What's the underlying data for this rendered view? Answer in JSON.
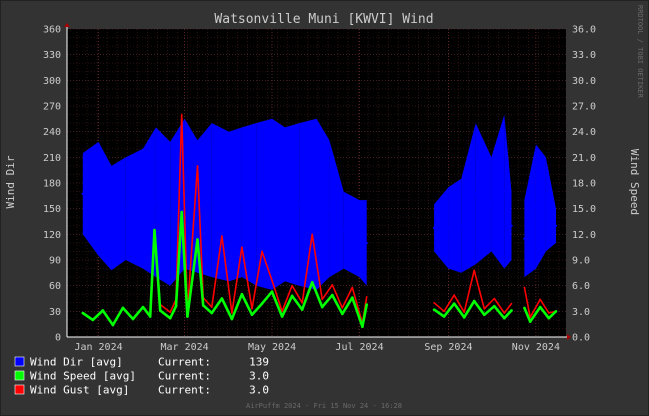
{
  "chart_data": {
    "type": "area",
    "title": "Watsonville Muni [KWVI] Wind",
    "ylabel": "Wind Dir",
    "y2label": "Wind Speed",
    "ylim": [
      0,
      360
    ],
    "y2lim": [
      0,
      36
    ],
    "yticks": [
      "0",
      "30",
      "60",
      "90",
      "120",
      "150",
      "180",
      "210",
      "240",
      "270",
      "300",
      "330",
      "360"
    ],
    "y2ticks": [
      "0.0",
      "3.0",
      "6.0",
      "9.0",
      "12.0",
      "15.0",
      "18.0",
      "21.0",
      "24.0",
      "27.0",
      "30.0",
      "33.0",
      "36.0"
    ],
    "xlim": [
      "2023-12-10",
      "2024-11-22"
    ],
    "xticks": [
      {
        "date": "2024-01-01",
        "label": "Jan 2024"
      },
      {
        "date": "2024-03-01",
        "label": "Mar 2024"
      },
      {
        "date": "2024-05-01",
        "label": "May 2024"
      },
      {
        "date": "2024-07-01",
        "label": "Jul 2024"
      },
      {
        "date": "2024-09-01",
        "label": "Sep 2024"
      },
      {
        "date": "2024-11-01",
        "label": "Nov 2024"
      }
    ],
    "grid": true,
    "legend_position": "bottom-left",
    "watermark": "RRDTOOL / TOBI OETIKER",
    "footer": "AirPuffm 2024 - Fri 15 Nov 24 - 16:28",
    "gaps": [
      [
        "2024-07-07",
        "2024-08-21"
      ],
      [
        "2024-10-16",
        "2024-10-23"
      ]
    ],
    "series": [
      {
        "name": "Wind Dir",
        "axis": "left",
        "style": "band",
        "color": "#0000ff",
        "legend_label": "Wind Dir   [avg]",
        "current_label": "Current:",
        "current": "139",
        "points": [
          {
            "x": "2023-12-21",
            "low": 120,
            "high": 215
          },
          {
            "x": "2024-01-01",
            "low": 95,
            "high": 228
          },
          {
            "x": "2024-01-10",
            "low": 78,
            "high": 200
          },
          {
            "x": "2024-01-20",
            "low": 90,
            "high": 210
          },
          {
            "x": "2024-02-01",
            "low": 80,
            "high": 220
          },
          {
            "x": "2024-02-10",
            "low": 70,
            "high": 245
          },
          {
            "x": "2024-02-20",
            "low": 60,
            "high": 228
          },
          {
            "x": "2024-03-01",
            "low": 80,
            "high": 255
          },
          {
            "x": "2024-03-10",
            "low": 75,
            "high": 230
          },
          {
            "x": "2024-03-20",
            "low": 70,
            "high": 250
          },
          {
            "x": "2024-04-01",
            "low": 65,
            "high": 240
          },
          {
            "x": "2024-04-10",
            "low": 70,
            "high": 245
          },
          {
            "x": "2024-04-20",
            "low": 60,
            "high": 250
          },
          {
            "x": "2024-05-01",
            "low": 55,
            "high": 255
          },
          {
            "x": "2024-05-10",
            "low": 65,
            "high": 245
          },
          {
            "x": "2024-05-20",
            "low": 60,
            "high": 250
          },
          {
            "x": "2024-06-01",
            "low": 55,
            "high": 255
          },
          {
            "x": "2024-06-10",
            "low": 70,
            "high": 230
          },
          {
            "x": "2024-06-20",
            "low": 80,
            "high": 170
          },
          {
            "x": "2024-07-01",
            "low": 70,
            "high": 160
          },
          {
            "x": "2024-07-06",
            "low": 60,
            "high": 160
          },
          {
            "x": "2024-08-22",
            "low": 100,
            "high": 155
          },
          {
            "x": "2024-09-01",
            "low": 80,
            "high": 175
          },
          {
            "x": "2024-09-10",
            "low": 75,
            "high": 185
          },
          {
            "x": "2024-09-20",
            "low": 85,
            "high": 250
          },
          {
            "x": "2024-10-01",
            "low": 100,
            "high": 210
          },
          {
            "x": "2024-10-10",
            "low": 80,
            "high": 260
          },
          {
            "x": "2024-10-15",
            "low": 90,
            "high": 170
          },
          {
            "x": "2024-10-24",
            "low": 70,
            "high": 160
          },
          {
            "x": "2024-11-01",
            "low": 80,
            "high": 225
          },
          {
            "x": "2024-11-08",
            "low": 100,
            "high": 210
          },
          {
            "x": "2024-11-15",
            "low": 110,
            "high": 150
          }
        ]
      },
      {
        "name": "Wind Speed",
        "axis": "right",
        "style": "line",
        "color": "#00ff00",
        "legend_label": "Wind Speed [avg]",
        "current_label": "Current:",
        "current": "3.0",
        "points": [
          {
            "x": "2023-12-21",
            "y": 2.8
          },
          {
            "x": "2023-12-28",
            "y": 2.0
          },
          {
            "x": "2024-01-04",
            "y": 3.1
          },
          {
            "x": "2024-01-11",
            "y": 1.4
          },
          {
            "x": "2024-01-18",
            "y": 3.4
          },
          {
            "x": "2024-01-25",
            "y": 2.1
          },
          {
            "x": "2024-02-01",
            "y": 3.5
          },
          {
            "x": "2024-02-06",
            "y": 2.4
          },
          {
            "x": "2024-02-09",
            "y": 12.5
          },
          {
            "x": "2024-02-13",
            "y": 3.1
          },
          {
            "x": "2024-02-20",
            "y": 2.2
          },
          {
            "x": "2024-02-24",
            "y": 3.6
          },
          {
            "x": "2024-02-28",
            "y": 14.6
          },
          {
            "x": "2024-03-03",
            "y": 2.4
          },
          {
            "x": "2024-03-10",
            "y": 11.4
          },
          {
            "x": "2024-03-14",
            "y": 3.7
          },
          {
            "x": "2024-03-20",
            "y": 2.8
          },
          {
            "x": "2024-03-27",
            "y": 4.5
          },
          {
            "x": "2024-04-03",
            "y": 2.1
          },
          {
            "x": "2024-04-10",
            "y": 5.0
          },
          {
            "x": "2024-04-17",
            "y": 2.6
          },
          {
            "x": "2024-04-24",
            "y": 3.9
          },
          {
            "x": "2024-05-01",
            "y": 5.3
          },
          {
            "x": "2024-05-08",
            "y": 2.4
          },
          {
            "x": "2024-05-15",
            "y": 4.8
          },
          {
            "x": "2024-05-22",
            "y": 3.2
          },
          {
            "x": "2024-05-29",
            "y": 6.4
          },
          {
            "x": "2024-06-05",
            "y": 3.5
          },
          {
            "x": "2024-06-12",
            "y": 4.9
          },
          {
            "x": "2024-06-19",
            "y": 2.7
          },
          {
            "x": "2024-06-26",
            "y": 4.6
          },
          {
            "x": "2024-07-03",
            "y": 1.2
          },
          {
            "x": "2024-07-06",
            "y": 3.8
          },
          {
            "x": "2024-08-22",
            "y": 3.2
          },
          {
            "x": "2024-08-29",
            "y": 2.4
          },
          {
            "x": "2024-09-05",
            "y": 3.9
          },
          {
            "x": "2024-09-12",
            "y": 2.3
          },
          {
            "x": "2024-09-19",
            "y": 4.2
          },
          {
            "x": "2024-09-26",
            "y": 2.6
          },
          {
            "x": "2024-10-03",
            "y": 3.6
          },
          {
            "x": "2024-10-10",
            "y": 2.2
          },
          {
            "x": "2024-10-15",
            "y": 3.1
          },
          {
            "x": "2024-10-24",
            "y": 3.4
          },
          {
            "x": "2024-10-28",
            "y": 1.8
          },
          {
            "x": "2024-11-04",
            "y": 3.5
          },
          {
            "x": "2024-11-10",
            "y": 2.2
          },
          {
            "x": "2024-11-15",
            "y": 3.0
          }
        ]
      },
      {
        "name": "Wind Gust",
        "axis": "right",
        "style": "line",
        "color": "#ff0000",
        "legend_label": "Wind Gust  [avg]",
        "current_label": "Current:",
        "current": "3.0",
        "points": [
          {
            "x": "2024-02-13",
            "y": 3.8
          },
          {
            "x": "2024-02-20",
            "y": 2.9
          },
          {
            "x": "2024-02-24",
            "y": 4.4
          },
          {
            "x": "2024-02-28",
            "y": 26.0
          },
          {
            "x": "2024-03-03",
            "y": 3.0
          },
          {
            "x": "2024-03-10",
            "y": 20.0
          },
          {
            "x": "2024-03-14",
            "y": 4.6
          },
          {
            "x": "2024-03-20",
            "y": 3.5
          },
          {
            "x": "2024-03-27",
            "y": 11.8
          },
          {
            "x": "2024-04-03",
            "y": 2.8
          },
          {
            "x": "2024-04-10",
            "y": 10.5
          },
          {
            "x": "2024-04-17",
            "y": 3.3
          },
          {
            "x": "2024-04-24",
            "y": 10.0
          },
          {
            "x": "2024-05-01",
            "y": 6.6
          },
          {
            "x": "2024-05-08",
            "y": 3.0
          },
          {
            "x": "2024-05-15",
            "y": 6.0
          },
          {
            "x": "2024-05-22",
            "y": 4.0
          },
          {
            "x": "2024-05-29",
            "y": 12.0
          },
          {
            "x": "2024-06-05",
            "y": 4.4
          },
          {
            "x": "2024-06-12",
            "y": 6.1
          },
          {
            "x": "2024-06-19",
            "y": 3.4
          },
          {
            "x": "2024-06-26",
            "y": 5.8
          },
          {
            "x": "2024-07-03",
            "y": 1.6
          },
          {
            "x": "2024-07-06",
            "y": 4.7
          },
          {
            "x": "2024-08-22",
            "y": 4.0
          },
          {
            "x": "2024-08-29",
            "y": 3.0
          },
          {
            "x": "2024-09-05",
            "y": 4.9
          },
          {
            "x": "2024-09-12",
            "y": 2.9
          },
          {
            "x": "2024-09-19",
            "y": 7.8
          },
          {
            "x": "2024-09-26",
            "y": 3.3
          },
          {
            "x": "2024-10-03",
            "y": 4.5
          },
          {
            "x": "2024-10-10",
            "y": 2.8
          },
          {
            "x": "2024-10-15",
            "y": 3.9
          },
          {
            "x": "2024-10-24",
            "y": 5.8
          },
          {
            "x": "2024-10-28",
            "y": 2.3
          },
          {
            "x": "2024-11-04",
            "y": 4.4
          },
          {
            "x": "2024-11-10",
            "y": 2.8
          },
          {
            "x": "2024-11-15",
            "y": 3.0
          }
        ]
      }
    ]
  }
}
